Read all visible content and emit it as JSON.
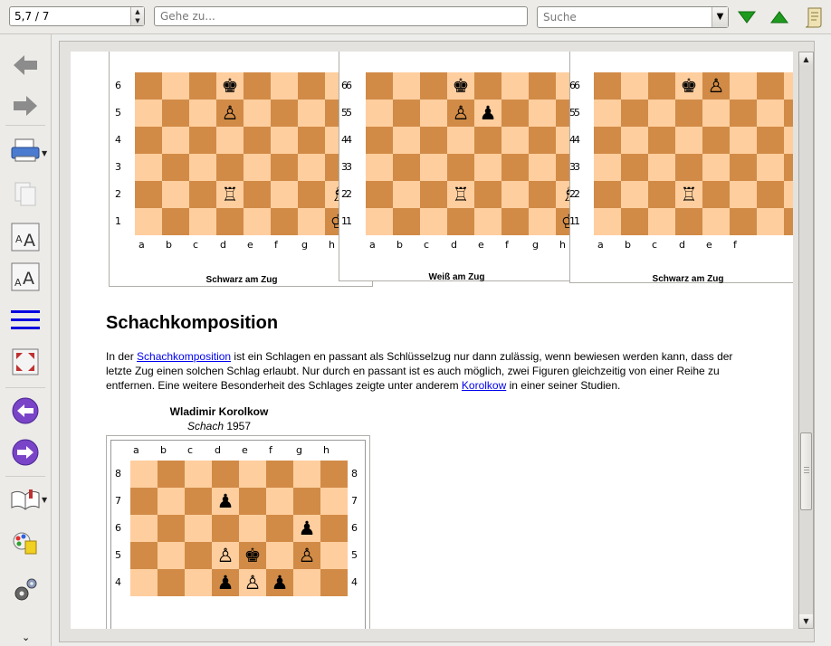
{
  "toolbar": {
    "page_value": "5,7 / 7",
    "goto_placeholder": "Gehe zu...",
    "search_placeholder": "Suche",
    "next_result_icon": "green-down-triangle-icon",
    "prev_result_icon": "green-up-triangle-icon",
    "notes_icon": "scroll-icon"
  },
  "sidebar": {
    "items": [
      {
        "name": "back-arrow-icon"
      },
      {
        "name": "forward-arrow-icon"
      },
      {
        "name": "print-icon"
      },
      {
        "name": "copy-icon"
      },
      {
        "name": "zoom-in-font-icon"
      },
      {
        "name": "zoom-out-font-icon"
      },
      {
        "name": "menu-lines-icon"
      },
      {
        "name": "fullscreen-icon"
      },
      {
        "name": "previous-circle-icon"
      },
      {
        "name": "next-circle-icon"
      },
      {
        "name": "book-icon"
      },
      {
        "name": "paint-icon"
      },
      {
        "name": "settings-gears-icon"
      }
    ],
    "more_glyph": "⌄"
  },
  "content": {
    "boards_top": [
      {
        "caption": "Schwarz am Zug",
        "ranks": [
          "6",
          "5",
          "4",
          "3",
          "2",
          "1"
        ],
        "files": [
          "a",
          "b",
          "c",
          "d",
          "e",
          "f",
          "g",
          "h"
        ]
      },
      {
        "caption": "Weiß am Zug",
        "ranks": [
          "6",
          "5",
          "4",
          "3",
          "2",
          "1"
        ],
        "rank_prefix": [
          "6",
          "5",
          "4",
          "3",
          "2",
          "1"
        ],
        "files": [
          "a",
          "b",
          "c",
          "d",
          "e",
          "f",
          "g",
          "h"
        ]
      },
      {
        "caption": "Schwarz am Zug",
        "ranks": [
          "6",
          "5",
          "4",
          "3",
          "2",
          "1"
        ],
        "rank_prefix": [
          "6",
          "5",
          "4",
          "3",
          "2",
          "1"
        ],
        "files": [
          "a",
          "b",
          "c",
          "d",
          "e",
          "f"
        ]
      }
    ],
    "heading": "Schachkomposition",
    "para": {
      "t1": "In der ",
      "link1": "Schachkomposition",
      "t2": " ist ein Schlagen en passant als Schlüsselzug nur dann zulässig, wenn bewiesen werden kann, dass der letzte Zug einen solchen Schlag erlaubt. Nur durch en passant ist es auch möglich, zwei Figuren gleichzeitig von einer Reihe zu entfernen. Eine weitere Besonderheit des Schlages zeigte unter anderem ",
      "link2": "Korolkow",
      "t3": " in einer seiner Studien."
    },
    "composer_name": "Wladimir Korolkow",
    "source_italic": "Schach",
    "source_year": " 1957",
    "study_board": {
      "files": [
        "a",
        "b",
        "c",
        "d",
        "e",
        "f",
        "g",
        "h"
      ],
      "ranks": [
        "8",
        "7",
        "6",
        "5",
        "4"
      ]
    }
  },
  "colors": {
    "light": "#ffce9e",
    "dark": "#d18b47",
    "highlight": "#0000ee"
  }
}
